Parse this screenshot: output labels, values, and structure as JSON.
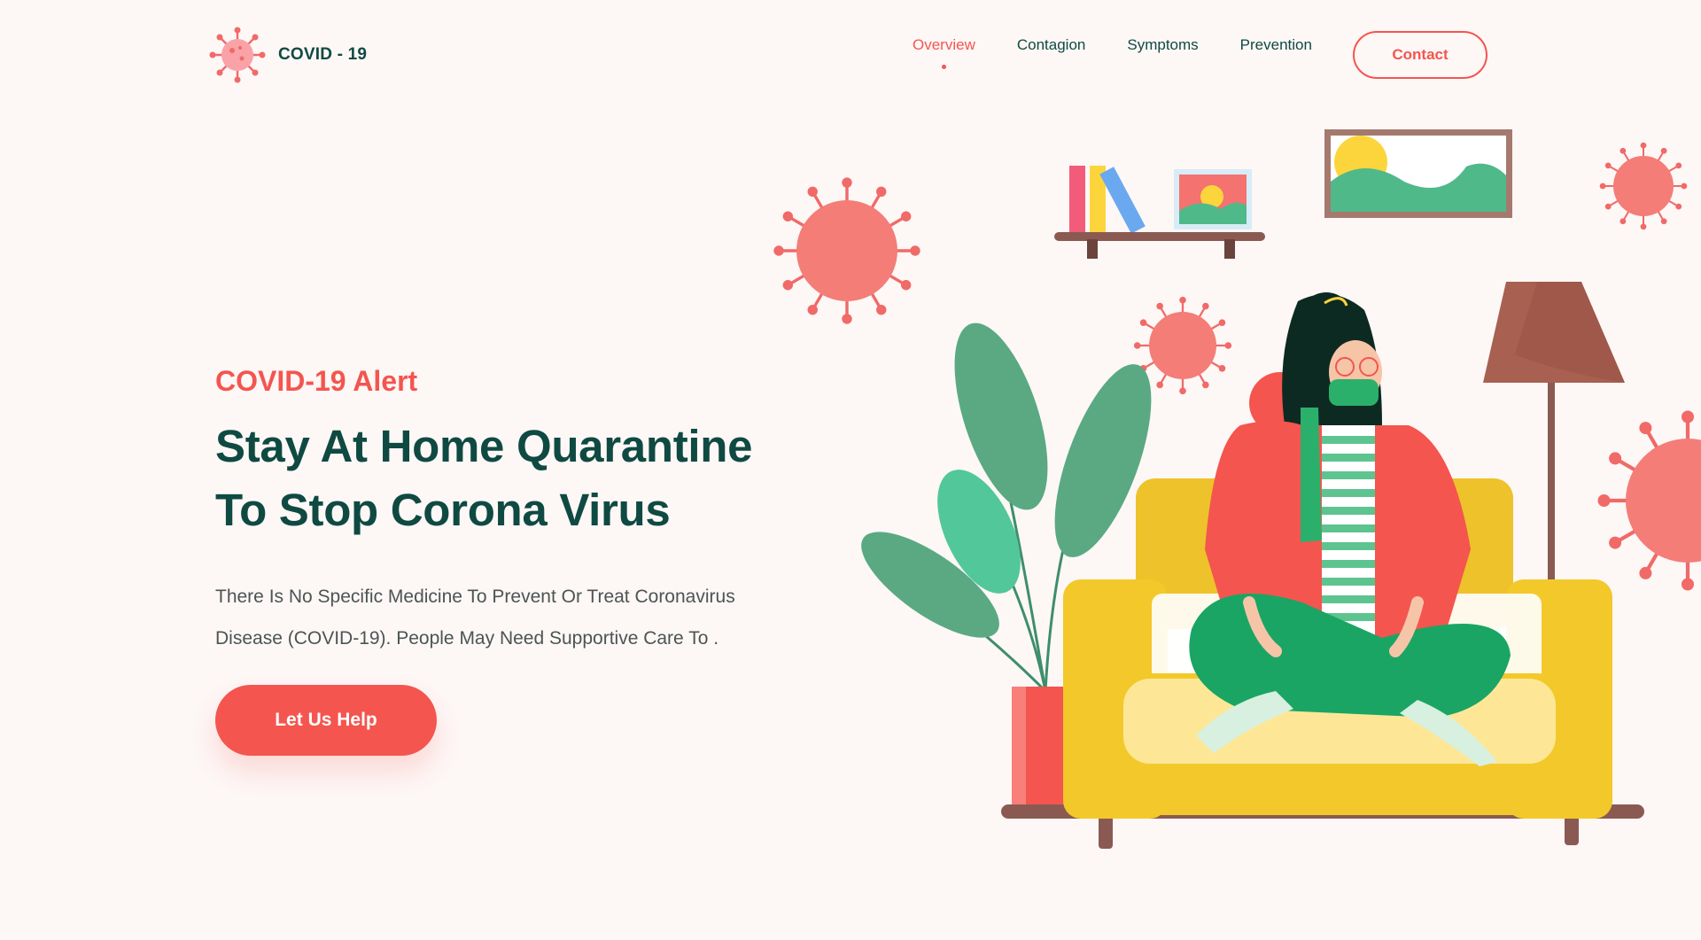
{
  "brand": {
    "name": "COVID - 19",
    "logo_icon": "virus-icon",
    "accent": "#f4554f",
    "dark": "#0f4a42"
  },
  "nav": {
    "items": [
      {
        "label": "Overview",
        "active": true
      },
      {
        "label": "Contagion",
        "active": false
      },
      {
        "label": "Symptoms",
        "active": false
      },
      {
        "label": "Prevention",
        "active": false
      }
    ],
    "contact_label": "Contact"
  },
  "hero": {
    "alert": "COVID-19 Alert",
    "headline_line1": "Stay At Home Quarantine",
    "headline_line2": "To Stop Corona Virus",
    "description_line1": "There Is No Specific Medicine To Prevent Or Treat Coronavirus",
    "description_line2": "Disease (COVID-19). People May Need Supportive Care To .",
    "cta_label": "Let Us Help"
  }
}
